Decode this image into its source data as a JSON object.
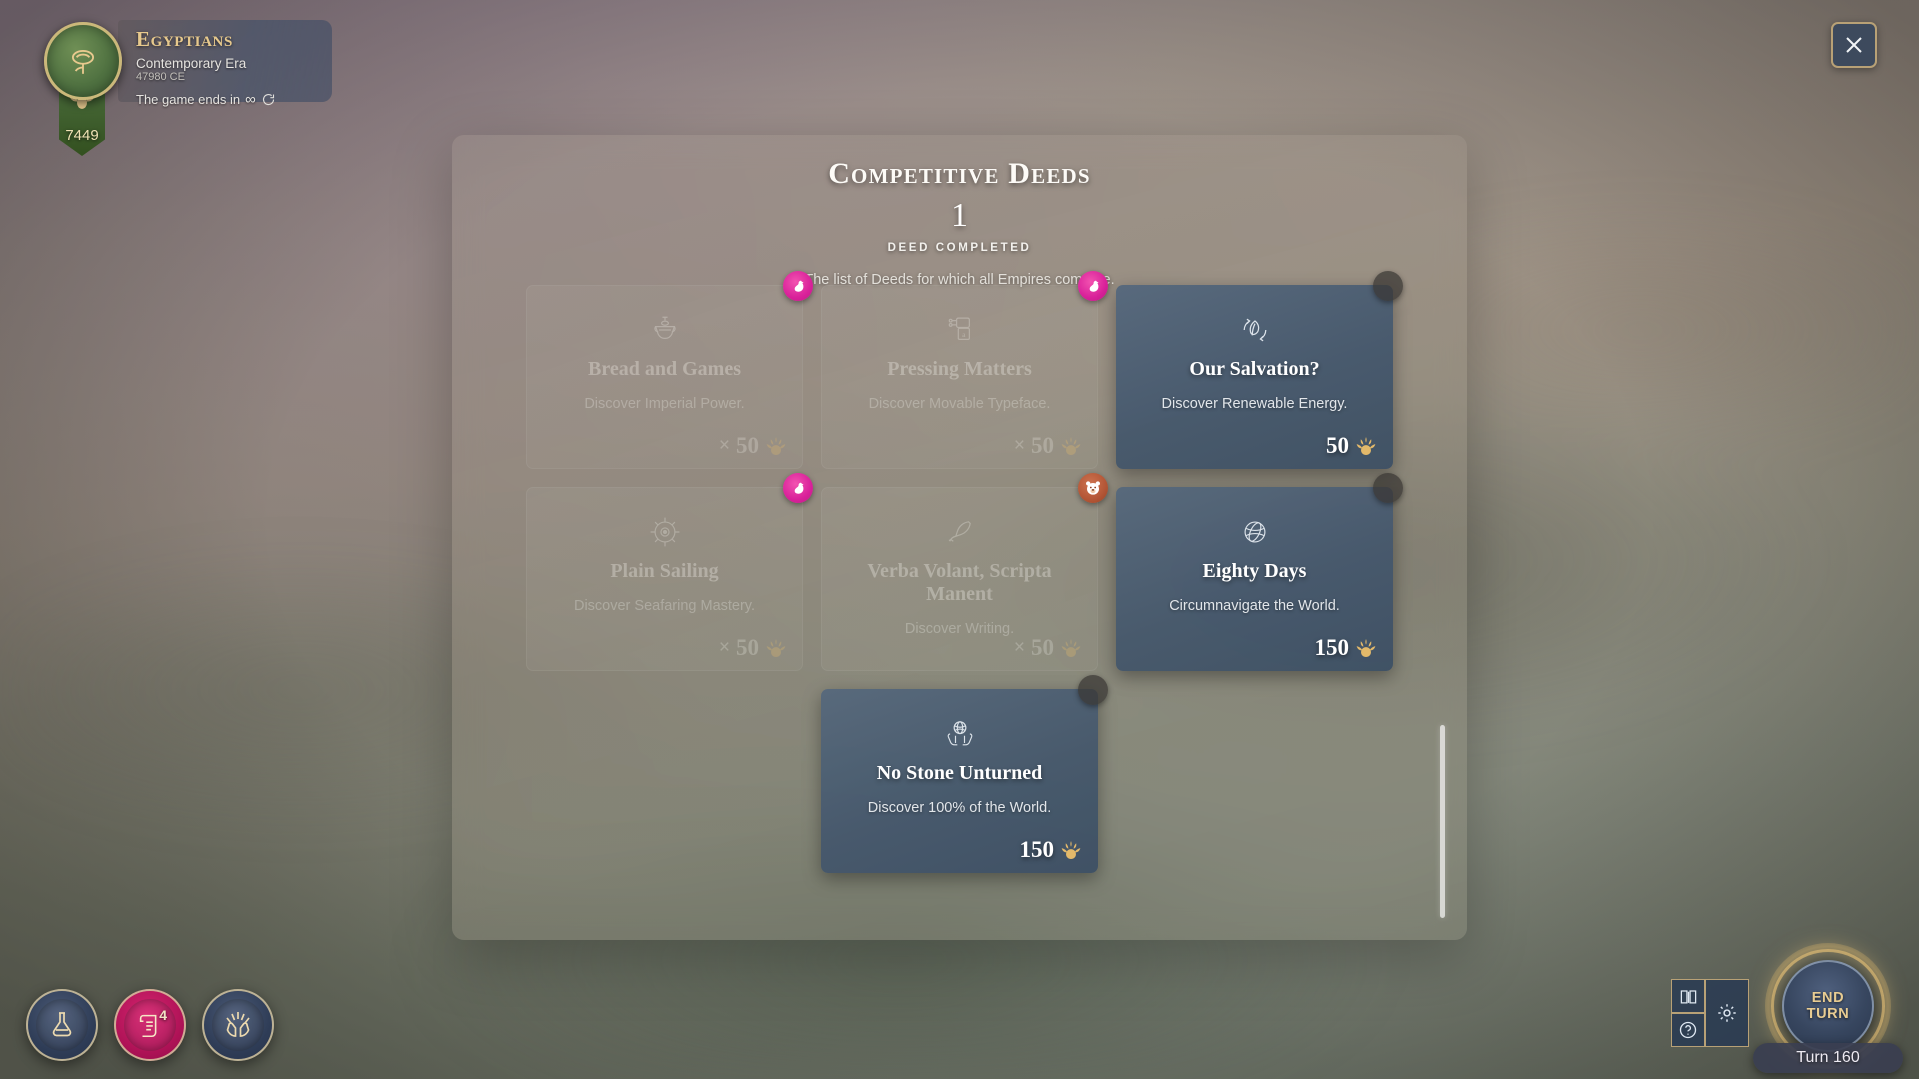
{
  "empire_hud": {
    "name": "Egyptians",
    "era": "Contemporary Era",
    "year": "47980 CE",
    "end_condition": "The game ends in",
    "infinity_symbol": "∞",
    "score": "7449",
    "crest_icon": "rose-emblem-icon",
    "banner_icon": "lotus-emblem-icon"
  },
  "modal": {
    "title": "Competitive Deeds",
    "count": "1",
    "count_label": "DEED COMPLETED",
    "description": "The list of Deeds for which all Empires compete.",
    "close_icon": "close-icon",
    "scrollbar": "vertical-scrollbar"
  },
  "deeds": [
    {
      "title": "Bread and Games",
      "requirement": "Discover Imperial Power.",
      "reward": "50",
      "reward_prefix": "×",
      "state": "dim",
      "icon": "amphora-icon",
      "owner_badge": "pink",
      "owner_icon": "swan-avatar-icon"
    },
    {
      "title": "Pressing Matters",
      "requirement": "Discover Movable Typeface.",
      "reward": "50",
      "reward_prefix": "×",
      "state": "dim",
      "icon": "printing-press-icon",
      "owner_badge": "pink",
      "owner_icon": "swan-avatar-icon"
    },
    {
      "title": "Our Salvation?",
      "requirement": "Discover Renewable Energy.",
      "reward": "50",
      "reward_prefix": "",
      "state": "completed",
      "icon": "renewable-leaf-icon",
      "owner_badge": "none",
      "owner_icon": "empty-avatar-icon"
    },
    {
      "title": "Plain Sailing",
      "requirement": "Discover Seafaring Mastery.",
      "reward": "50",
      "reward_prefix": "×",
      "state": "dim",
      "icon": "compass-rose-icon",
      "owner_badge": "pink",
      "owner_icon": "swan-avatar-icon"
    },
    {
      "title": "Verba Volant, Scripta Manent",
      "requirement": "Discover Writing.",
      "reward": "50",
      "reward_prefix": "×",
      "state": "dim",
      "icon": "quill-pen-icon",
      "owner_badge": "orange",
      "owner_icon": "bear-avatar-icon"
    },
    {
      "title": "Eighty Days",
      "requirement": "Circumnavigate the World.",
      "reward": "150",
      "reward_prefix": "",
      "state": "completed",
      "icon": "globe-icon",
      "owner_badge": "none",
      "owner_icon": "empty-avatar-icon"
    },
    {
      "title": "No Stone Unturned",
      "requirement": "Discover 100% of the World.",
      "reward": "150",
      "reward_prefix": "",
      "state": "completed",
      "icon": "hands-holding-globe-icon",
      "owner_badge": "none",
      "owner_icon": "empty-avatar-icon"
    }
  ],
  "bottom_left_buttons": [
    {
      "name": "research",
      "icon": "flask-icon",
      "color": "blue",
      "badge": ""
    },
    {
      "name": "deeds",
      "icon": "scroll-icon",
      "color": "pink",
      "badge": "4"
    },
    {
      "name": "faith",
      "icon": "hands-faith-icon",
      "color": "blue",
      "badge": ""
    }
  ],
  "bottom_right": {
    "end_turn_line1": "END",
    "end_turn_line2": "TURN",
    "turn_label": "Turn 160",
    "book_icon": "book-icon",
    "help_icon": "help-icon",
    "settings_icon": "gear-icon"
  },
  "colors": {
    "fame_gold": "#e3b96a",
    "accent_gold": "#e8cc92",
    "card_blue": "#56687c",
    "badge_pink": "#d9219a",
    "badge_orange": "#b45636"
  }
}
